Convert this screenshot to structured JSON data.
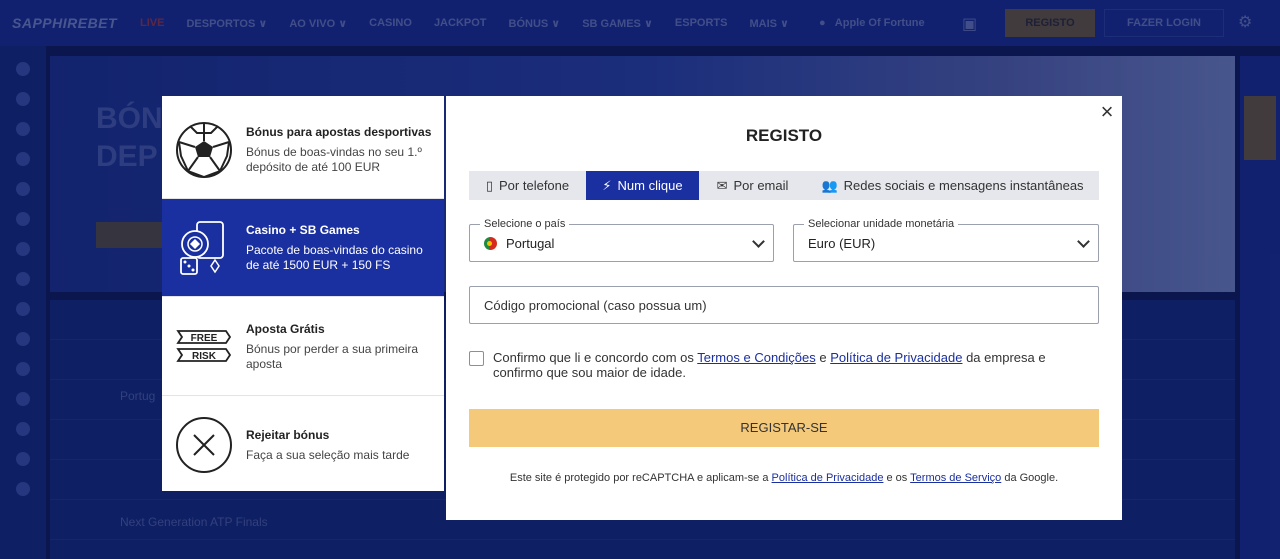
{
  "background": {
    "logo": "SAPPHIREBET",
    "nav": [
      "LIVE",
      "DESPORTOS ∨",
      "AO VIVO ∨",
      "CASINO",
      "JACKPOT",
      "BÓNUS ∨",
      "SB GAMES ∨",
      "ESPORTS",
      "MAIS ∨"
    ],
    "apple_label": "Apple Of Fortune",
    "register_label": "REGISTO",
    "login_label": "FAZER LOGIN",
    "hero_title_line1": "BÓN",
    "hero_title_line2": "DEP",
    "row1": "Portug",
    "row2": "Next Generation ATP Finals"
  },
  "bonus": {
    "items": [
      {
        "title": "Bónus para apostas desportivas",
        "desc": "Bónus de boas-vindas no seu 1.º depósito de até 100 EUR",
        "icon": "soccer-ball-icon",
        "active": false
      },
      {
        "title": "Casino + SB Games",
        "desc": "Pacote de boas-vindas do casino de até 1500 EUR + 150 FS",
        "icon": "casino-chips-icon",
        "active": true
      },
      {
        "title": "Aposta Grátis",
        "desc": "Bónus por perder a sua primeira aposta",
        "icon": "free-risk-icon",
        "active": false
      },
      {
        "title": "Rejeitar bónus",
        "desc": "Faça a sua seleção mais tarde",
        "icon": "reject-x-icon",
        "active": false
      }
    ],
    "free_label": "FREE",
    "risk_label": "RISK"
  },
  "modal": {
    "title": "REGISTO",
    "close": "×",
    "tabs": [
      {
        "label": "Por telefone",
        "icon": "phone-icon"
      },
      {
        "label": "Num clique",
        "icon": "lightning-icon",
        "active": true
      },
      {
        "label": "Por email",
        "icon": "envelope-icon"
      },
      {
        "label": "Redes sociais e mensagens instantâneas",
        "icon": "people-icon"
      }
    ],
    "country": {
      "label": "Selecione o país",
      "value": "Portugal"
    },
    "currency": {
      "label": "Selecionar unidade monetária",
      "value": "Euro (EUR)"
    },
    "promo_placeholder": "Código promocional (caso possua um)",
    "terms": {
      "pre": "Confirmo que li e concordo com os ",
      "link1": "Termos e Condições",
      "mid": " e ",
      "link2": "Política de Privacidade",
      "post": " da empresa e confirmo que sou maior de idade."
    },
    "submit": "REGISTAR-SE",
    "recaptcha": {
      "pre": "Este site é protegido por reCAPTCHA e aplicam-se a ",
      "link1": "Política de Privacidade",
      "mid": " e os ",
      "link2": "Termos de Serviço",
      "post": " da Google."
    }
  },
  "colors": {
    "accent": "#1a2fa0",
    "submit": "#f4c97a"
  }
}
